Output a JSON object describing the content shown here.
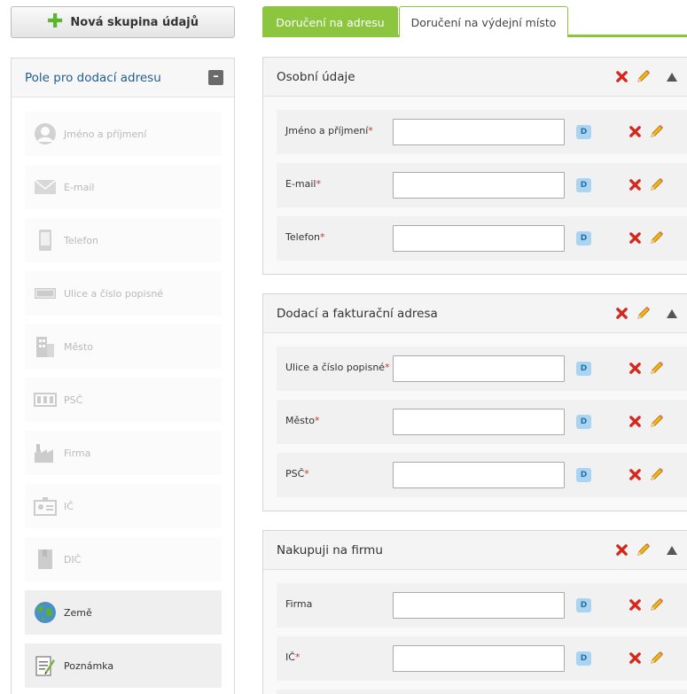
{
  "toolbar": {
    "new_group_label": "Nová skupina údajů"
  },
  "sidebar": {
    "title": "Pole pro dodací adresu",
    "collapse_label": "–",
    "items": [
      {
        "label": "Jméno a příjmení",
        "icon": "person-icon",
        "state": "disabled"
      },
      {
        "label": "E-mail",
        "icon": "envelope-icon",
        "state": "disabled"
      },
      {
        "label": "Telefon",
        "icon": "phone-icon",
        "state": "disabled"
      },
      {
        "label": "Ulice a číslo popisné",
        "icon": "street-sign-icon",
        "state": "disabled"
      },
      {
        "label": "Město",
        "icon": "building-icon",
        "state": "disabled"
      },
      {
        "label": "PSČ",
        "icon": "postcode-icon",
        "state": "disabled"
      },
      {
        "label": "Firma",
        "icon": "factory-icon",
        "state": "disabled"
      },
      {
        "label": "IČ",
        "icon": "id-card-icon",
        "state": "disabled"
      },
      {
        "label": "DIČ",
        "icon": "book-icon",
        "state": "disabled"
      },
      {
        "label": "Země",
        "icon": "globe-icon",
        "state": "active"
      },
      {
        "label": "Poznámka",
        "icon": "note-icon",
        "state": "active"
      }
    ]
  },
  "tabs": [
    {
      "label": "Doručení na adresu",
      "active": true
    },
    {
      "label": "Doručení na výdejní místo",
      "active": false
    }
  ],
  "sections": [
    {
      "title": "Osobní údaje",
      "fields": [
        {
          "label": "Jméno a příjmení",
          "required": "*",
          "value": "",
          "badge": "D"
        },
        {
          "label": "E-mail",
          "required": "*",
          "value": "",
          "badge": "D"
        },
        {
          "label": "Telefon",
          "required": "*",
          "value": "",
          "badge": "D"
        }
      ]
    },
    {
      "title": "Dodací a fakturační adresa",
      "fields": [
        {
          "label": "Ulice a číslo popisné",
          "required": "*",
          "value": "",
          "badge": "D"
        },
        {
          "label": "Město",
          "required": "*",
          "value": "",
          "badge": "D"
        },
        {
          "label": "PSČ",
          "required": "*",
          "value": "",
          "badge": "D"
        }
      ]
    },
    {
      "title": "Nakupuji na firmu",
      "fields": [
        {
          "label": "Firma",
          "required": "",
          "value": "",
          "badge": "D"
        },
        {
          "label": "IČ",
          "required": "*",
          "value": "",
          "badge": "D"
        }
      ]
    }
  ],
  "colors": {
    "accent": "#8cc63f",
    "link": "#1f5d91",
    "required": "#c0392b",
    "delete": "#d9261c",
    "edit": "#f2b21b"
  }
}
